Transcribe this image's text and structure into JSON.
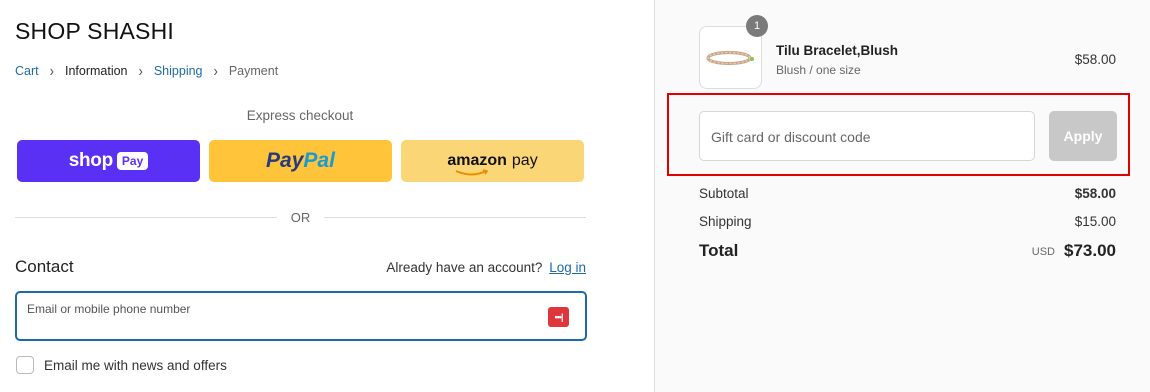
{
  "store": {
    "name": "SHOP SHASHI"
  },
  "breadcrumb": [
    {
      "label": "Cart"
    },
    {
      "label": "Information"
    },
    {
      "label": "Shipping"
    },
    {
      "label": "Payment"
    }
  ],
  "express": {
    "label": "Express checkout",
    "shop_pay": {
      "word": "shop",
      "pay": "Pay",
      "color": "#5a31f4"
    },
    "paypal": {
      "part1": "Pay",
      "part2": "Pal",
      "color": "#ffc439"
    },
    "amazon": {
      "word": "amazon",
      "pay": "pay",
      "color": "#fad677"
    }
  },
  "or_divider": "OR",
  "contact": {
    "heading": "Contact",
    "have_account": "Already have an account?",
    "login": "Log in",
    "email_placeholder": "Email or mobile phone number",
    "password_manager_icon": "dots-icon",
    "newsletter_label": "Email me with news and offers"
  },
  "order": {
    "item": {
      "name": "Tilu Bracelet,Blush",
      "variant": "Blush / one size",
      "price": "$58.00",
      "quantity": "1"
    },
    "discount": {
      "placeholder": "Gift card or discount code",
      "apply": "Apply"
    },
    "subtotal_label": "Subtotal",
    "subtotal": "$58.00",
    "shipping_label": "Shipping",
    "shipping": "$15.00",
    "total_label": "Total",
    "currency": "USD",
    "total": "$73.00"
  },
  "colors": {
    "link": "#1f6aa5",
    "highlight": "#e00000"
  }
}
